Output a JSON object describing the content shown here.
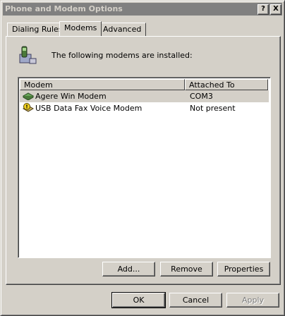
{
  "window": {
    "title": "Phone and Modem Options",
    "help_btn": "?",
    "close_btn": "X"
  },
  "tabs": [
    {
      "label": "Dialing Rules",
      "active": false
    },
    {
      "label": "Modems",
      "active": true
    },
    {
      "label": "Advanced",
      "active": false
    }
  ],
  "intro": {
    "icon": "phone-modem-icon",
    "text": "The following modems are  installed:"
  },
  "list": {
    "columns": [
      "Modem",
      "Attached To"
    ],
    "rows": [
      {
        "icon": "modem-icon",
        "name": "Agere Win Modem",
        "attached": "COM3",
        "selected": true
      },
      {
        "icon": "modem-warning-icon",
        "name": "USB Data Fax Voice Modem",
        "attached": "Not present",
        "selected": false
      }
    ]
  },
  "buttons": {
    "add": "Add...",
    "remove": "Remove",
    "properties": "Properties",
    "ok": "OK",
    "cancel": "Cancel",
    "apply": "Apply"
  }
}
